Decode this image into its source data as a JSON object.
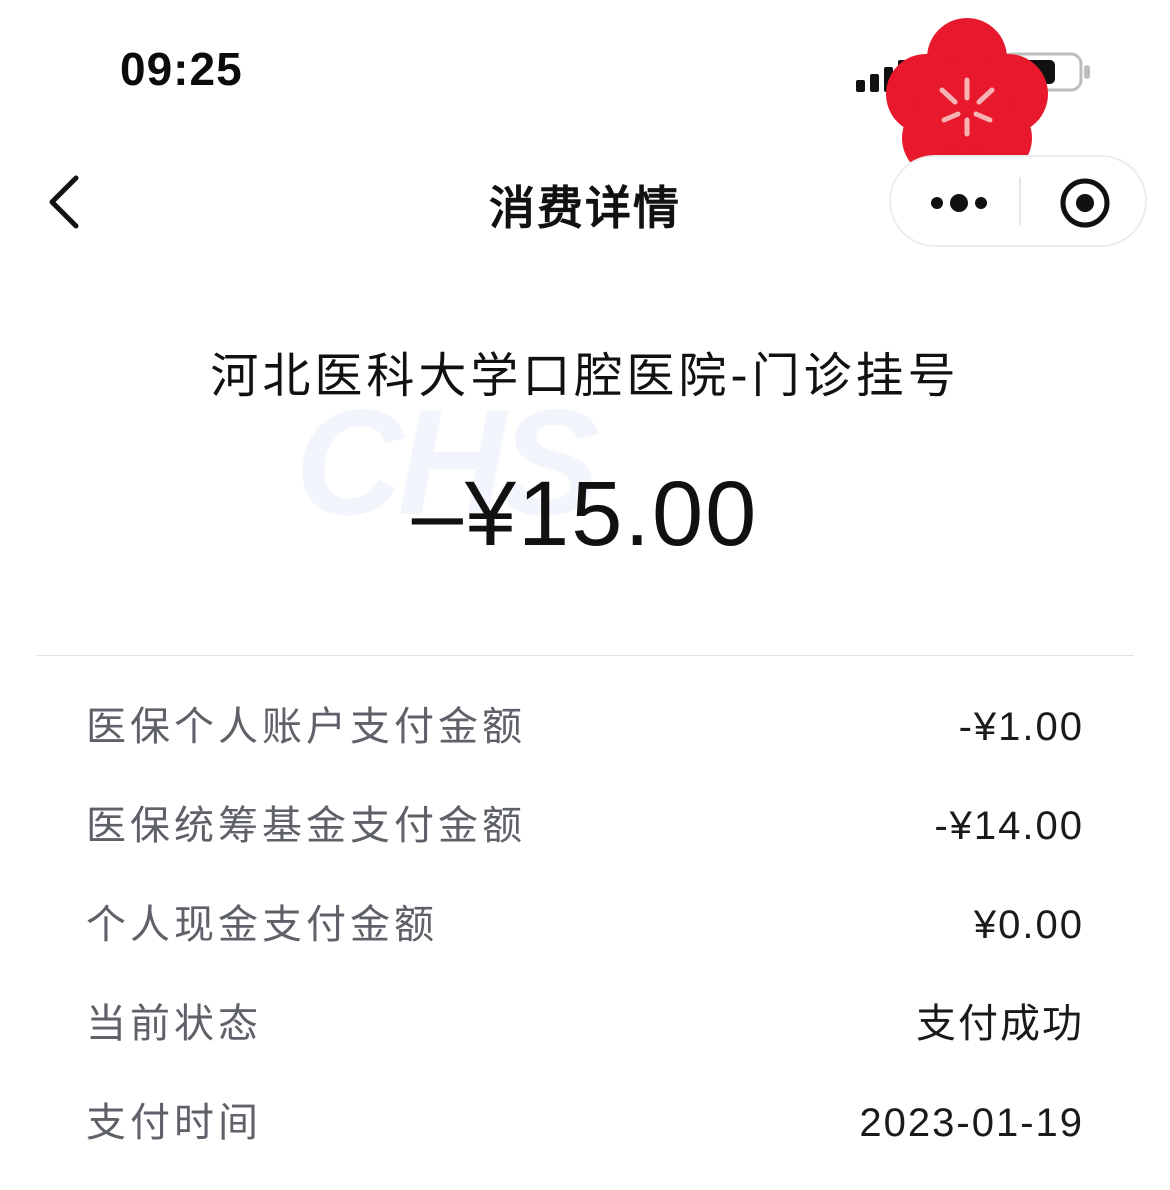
{
  "status_bar": {
    "time": "09:25"
  },
  "nav": {
    "title": "消费详情"
  },
  "watermark": "CHS",
  "merchant": "河北医科大学口腔医院-门诊挂号",
  "amount": "–¥15.00",
  "details": [
    {
      "label": "医保个人账户支付金额",
      "value": "-¥1.00"
    },
    {
      "label": "医保统筹基金支付金额",
      "value": "-¥14.00"
    },
    {
      "label": "个人现金支付金额",
      "value": "¥0.00"
    },
    {
      "label": "当前状态",
      "value": "支付成功"
    },
    {
      "label": "支付时间",
      "value": "2023-01-19"
    }
  ],
  "colors": {
    "stamp": "#e8192c",
    "label": "#5e6167",
    "text": "#111111"
  }
}
